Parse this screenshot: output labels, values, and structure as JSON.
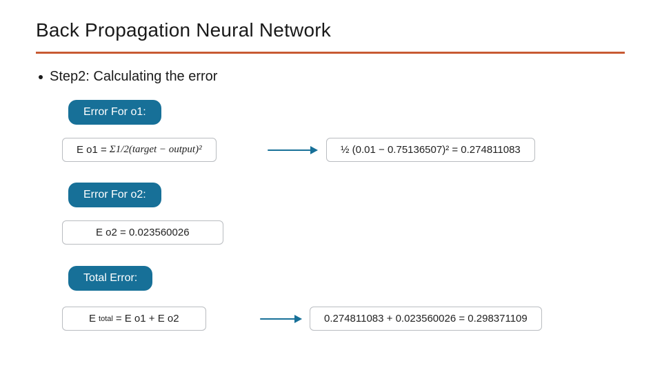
{
  "slide": {
    "title": "Back Propagation Neural Network",
    "bullet": "Step2: Calculating the error"
  },
  "labels": {
    "error_o1": "Error For o1:",
    "error_o2": "Error For o2:",
    "total": "Total Error:"
  },
  "formulas": {
    "e_o1_def_prefix": "E o1 = ",
    "e_o1_def_math": "Σ1/2(target − output)²",
    "e_o1_eval": "½ (0.01 − 0.75136507)² = 0.274811083",
    "e_o2_result": "E o2 = 0.023560026",
    "etotal_def_prefix": "E",
    "etotal_def_sub": "total",
    "etotal_def_rest": " = E o1 + E o2",
    "etotal_eval": "0.274811083 + 0.023560026 = 0.298371109"
  }
}
